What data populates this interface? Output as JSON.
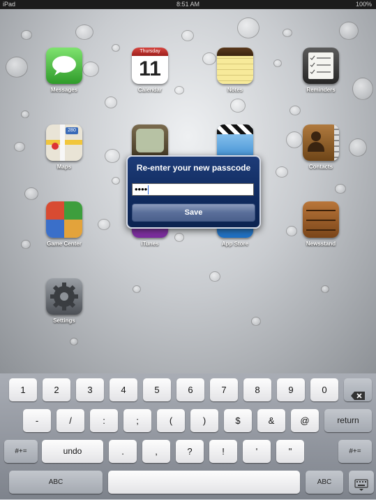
{
  "status": {
    "device": "iPad",
    "time": "8:51 AM",
    "battery": "100%"
  },
  "apps": [
    {
      "label": "Messages",
      "icon": "messages-icon"
    },
    {
      "label": "Calendar",
      "icon": "calendar-icon",
      "weekday": "Thursday",
      "day": "11"
    },
    {
      "label": "Notes",
      "icon": "notes-icon"
    },
    {
      "label": "Reminders",
      "icon": "reminders-icon"
    },
    {
      "label": "Maps",
      "icon": "maps-icon",
      "badge": "280"
    },
    {
      "label": "Contacts",
      "icon": "contacts-icon"
    },
    {
      "label": "Game Center",
      "icon": "game-center-icon"
    },
    {
      "label": "iTunes",
      "icon": "itunes-icon"
    },
    {
      "label": "App Store",
      "icon": "app-store-icon"
    },
    {
      "label": "Newsstand",
      "icon": "newsstand-icon"
    },
    {
      "label": "Settings",
      "icon": "settings-icon"
    }
  ],
  "dialog": {
    "title": "Re-enter your new passcode",
    "value": "••••",
    "save_label": "Save"
  },
  "keyboard": {
    "row1": [
      "1",
      "2",
      "3",
      "4",
      "5",
      "6",
      "7",
      "8",
      "9",
      "0"
    ],
    "row2": [
      "-",
      "/",
      ":",
      ";",
      "(",
      ")",
      "$",
      "&",
      "@"
    ],
    "row2_return": "return",
    "row3_left": "#+=",
    "row3_undo": "undo",
    "row3": [
      ".",
      ",",
      "?",
      "!",
      "'",
      "\""
    ],
    "row3_right": "#+=",
    "abc_left": "ABC",
    "abc_right": "ABC"
  }
}
